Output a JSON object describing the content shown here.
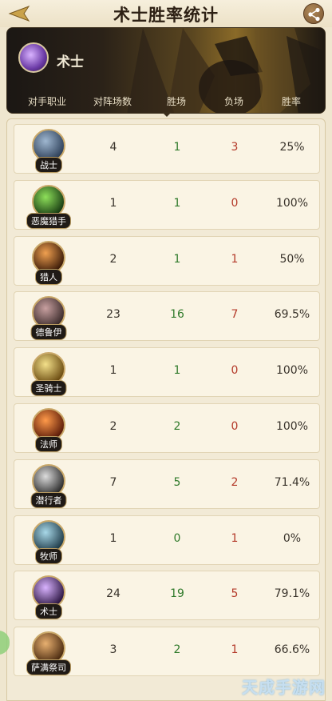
{
  "app": {
    "title": "术士胜率统计"
  },
  "header": {
    "class_name": "术士",
    "columns": [
      "对手职业",
      "对阵场数",
      "胜场",
      "负场",
      "胜率"
    ]
  },
  "rows": [
    {
      "cls": "战士",
      "games": "4",
      "wins": "1",
      "losses": "3",
      "rate": "25%",
      "icon": "warrior-icon"
    },
    {
      "cls": "恶魔猎手",
      "games": "1",
      "wins": "1",
      "losses": "0",
      "rate": "100%",
      "icon": "demon-hunter-icon"
    },
    {
      "cls": "猎人",
      "games": "2",
      "wins": "1",
      "losses": "1",
      "rate": "50%",
      "icon": "hunter-icon"
    },
    {
      "cls": "德鲁伊",
      "games": "23",
      "wins": "16",
      "losses": "7",
      "rate": "69.5%",
      "icon": "druid-icon"
    },
    {
      "cls": "圣骑士",
      "games": "1",
      "wins": "1",
      "losses": "0",
      "rate": "100%",
      "icon": "paladin-icon"
    },
    {
      "cls": "法师",
      "games": "2",
      "wins": "2",
      "losses": "0",
      "rate": "100%",
      "icon": "mage-icon"
    },
    {
      "cls": "潜行者",
      "games": "7",
      "wins": "5",
      "losses": "2",
      "rate": "71.4%",
      "icon": "rogue-icon"
    },
    {
      "cls": "牧师",
      "games": "1",
      "wins": "0",
      "losses": "1",
      "rate": "0%",
      "icon": "priest-icon"
    },
    {
      "cls": "术士",
      "games": "24",
      "wins": "19",
      "losses": "5",
      "rate": "79.1%",
      "icon": "warlock-icon"
    },
    {
      "cls": "萨满祭司",
      "games": "3",
      "wins": "2",
      "losses": "1",
      "rate": "66.6%",
      "icon": "shaman-icon"
    }
  ],
  "colors": {
    "win": "#2f7a2a",
    "loss": "#b43a2a",
    "background": "#efe6cf"
  },
  "watermark": "天成手游网"
}
